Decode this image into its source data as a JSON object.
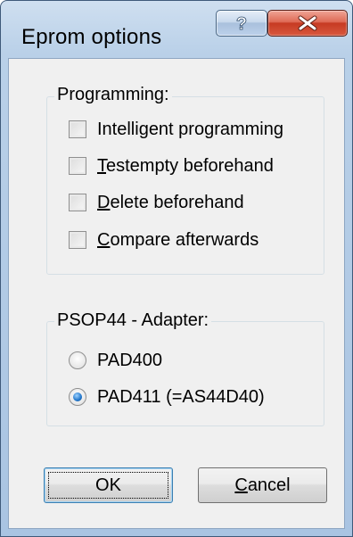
{
  "window": {
    "title": "Eprom options",
    "help_button_label": "?",
    "close_button_label": "X"
  },
  "programming_group": {
    "legend": "Programming:",
    "options": [
      {
        "pre": "",
        "mnemonic": "",
        "post": "Intelligent programming",
        "checked": false
      },
      {
        "pre": "",
        "mnemonic": "T",
        "post": "estempty beforehand",
        "checked": false
      },
      {
        "pre": "",
        "mnemonic": "D",
        "post": "elete beforehand",
        "checked": false
      },
      {
        "pre": "",
        "mnemonic": "C",
        "post": "ompare afterwards",
        "checked": false
      }
    ]
  },
  "adapter_group": {
    "legend": "PSOP44 - Adapter:",
    "options": [
      {
        "label": "PAD400",
        "selected": false
      },
      {
        "label": "PAD411 (=AS44D40)",
        "selected": true
      }
    ]
  },
  "buttons": {
    "ok_label": "OK",
    "cancel_mnemonic": "C",
    "cancel_rest": "ancel"
  }
}
